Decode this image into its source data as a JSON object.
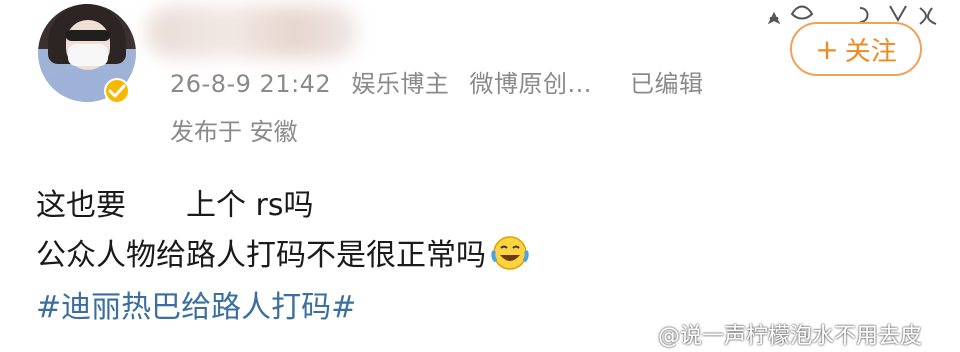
{
  "post": {
    "meta": {
      "timestamp": "26-8-9 21:42",
      "category": "娱乐博主",
      "source": "微博原创...",
      "edited": "已编辑",
      "location": "发布于 安徽"
    },
    "follow_button": {
      "plus": "+",
      "label": "关注"
    },
    "content": {
      "line1_part1": "这也要",
      "line1_part2": "上个 rs吗",
      "line2": "公众人物给路人打码不是很正常吗",
      "emoji": "laugh-cry-icon",
      "hashtag": "#迪丽热巴给路人打码#"
    },
    "watermark": "@说一声柠檬泡水不用去皮",
    "colors": {
      "meta_gray": "#8a8a8a",
      "follow_orange": "#f08a20",
      "hashtag_blue": "#3b6fa0",
      "verified_gold": "#f6b800"
    }
  }
}
